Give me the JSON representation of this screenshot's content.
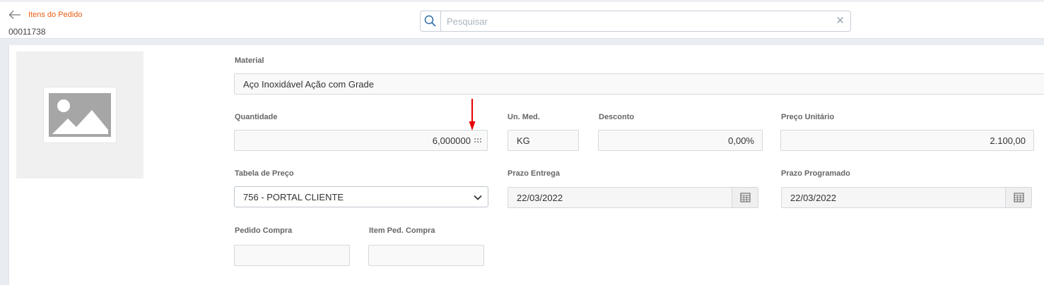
{
  "header": {
    "breadcrumb": "Itens do Pedido",
    "order_number": "00011738",
    "search": {
      "placeholder": "Pesquisar",
      "value": ""
    }
  },
  "form": {
    "material": {
      "label": "Material",
      "value": "Aço Inoxidável Ação com Grade"
    },
    "quantidade": {
      "label": "Quantidade",
      "value": "6,000000"
    },
    "unidade": {
      "label": "Un. Med.",
      "value": "KG"
    },
    "desconto": {
      "label": "Desconto",
      "value": "0,00%"
    },
    "preco_unitario": {
      "label": "Preço Unitário",
      "value": "2.100,00"
    },
    "tabela_preco": {
      "label": "Tabela de Preço",
      "value": "756 - PORTAL CLIENTE"
    },
    "prazo_entrega": {
      "label": "Prazo Entrega",
      "value": "22/03/2022"
    },
    "prazo_programado": {
      "label": "Prazo Programado",
      "value": "22/03/2022"
    },
    "pedido_compra": {
      "label": "Pedido Compra",
      "value": ""
    },
    "item_ped_compra": {
      "label": "Item Ped. Compra",
      "value": ""
    }
  },
  "colors": {
    "accent": "#e85d12",
    "annotation_arrow": "#e60000",
    "search_icon": "#2f6ea8"
  },
  "icons": [
    "back-arrow-icon",
    "search-icon",
    "clear-icon",
    "image-placeholder-icon",
    "grid-dots-icon",
    "chevron-down-icon",
    "calendar-icon"
  ]
}
